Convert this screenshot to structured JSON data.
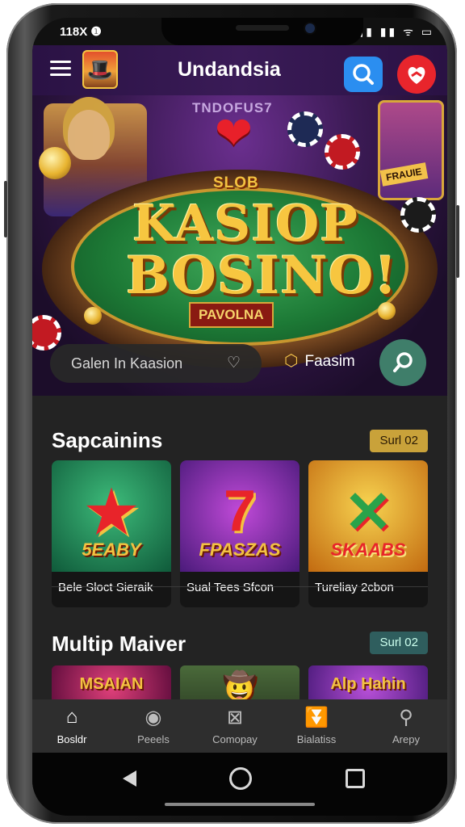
{
  "status_bar": {
    "time": "118X ❶",
    "icons": "▮▮▮ ▮▮ ᯤ ▭"
  },
  "app_bar": {
    "title": "Undandsia",
    "menu_icon": "hamburger-icon",
    "search_icon": "search-icon",
    "heart_icon": "heart-icon"
  },
  "hero": {
    "tag_top": "TNDOFUS7",
    "subtitle_top": "SLOB",
    "title_line1": "KASIOP",
    "title_line2": "BOSINO!",
    "sub_banner": "PAVOLNA",
    "card_label": "FRAUIE",
    "search_placeholder": "Galen In Kaasion",
    "favorite_label": "Faasim"
  },
  "section1": {
    "title": "Sapcainins",
    "pill": "Surl 02",
    "tiles": [
      {
        "word": "5EABY",
        "caption": "Bele Sloct Sieraik"
      },
      {
        "word": "FPASZAS",
        "caption": "Sual Tees Sfcon"
      },
      {
        "word": "SKAABS",
        "caption": "Tureliay 2cbon"
      }
    ]
  },
  "section2": {
    "title": "Multip Maiver",
    "pill": "Surl 02",
    "tiles": [
      {
        "word": "MSAIAN"
      },
      {
        "word": ""
      },
      {
        "word": "Alp Hahin"
      }
    ]
  },
  "bottom_nav": [
    {
      "label": "Bosldr",
      "icon": "home-icon"
    },
    {
      "label": "Peeels",
      "icon": "compass-icon"
    },
    {
      "label": "Comopay",
      "icon": "box-icon"
    },
    {
      "label": "Bialatiss",
      "icon": "chevrons-down-icon"
    },
    {
      "label": "Arepy",
      "icon": "search-icon"
    }
  ],
  "colors": {
    "accent_blue": "#2b8ef0",
    "accent_red": "#e8252c",
    "appbar": "#3a1b57",
    "gold": "#c9a23a"
  }
}
